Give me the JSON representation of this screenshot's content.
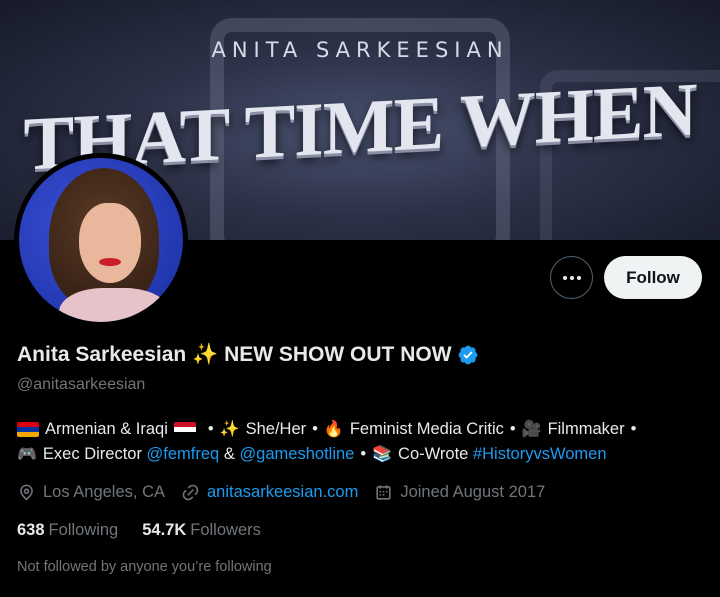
{
  "banner": {
    "subtitle": "ANITA SARKEESIAN",
    "title": "THAT TIME WHEN"
  },
  "profile": {
    "display_name": "Anita Sarkeesian ✨ NEW SHOW OUT NOW",
    "handle": "@anitasarkeesian",
    "verified_icon": "verified-badge-icon",
    "follow_label": "Follow",
    "more_icon": "more-options-icon"
  },
  "bio": {
    "line1": {
      "armenian": "Armenian & Iraqi",
      "sparkles": "✨",
      "pronouns": "She/Her",
      "fire": "🔥",
      "critic": "Feminist Media Critic",
      "camera": "🎥",
      "filmmaker": "Filmmaker",
      "sep": "•"
    },
    "line2": {
      "gamepad": "🎮",
      "exec": "Exec Director",
      "mention1": "@femfreq",
      "amp": "&",
      "mention2": "@gameshotline",
      "books": "📚",
      "cowrote": "Co-Wrote",
      "hashtag": "#HistoryvsWomen"
    }
  },
  "meta": {
    "location": "Los Angeles, CA",
    "website": "anitasarkeesian.com",
    "joined": "Joined August 2017"
  },
  "stats": {
    "following_count": "638",
    "following_label": "Following",
    "followers_count": "54.7K",
    "followers_label": "Followers"
  },
  "followed_note": "Not followed by anyone you’re following",
  "colors": {
    "accent": "#1d9bf0",
    "muted": "#71767b",
    "text": "#e7e9ea",
    "background": "#000000"
  }
}
